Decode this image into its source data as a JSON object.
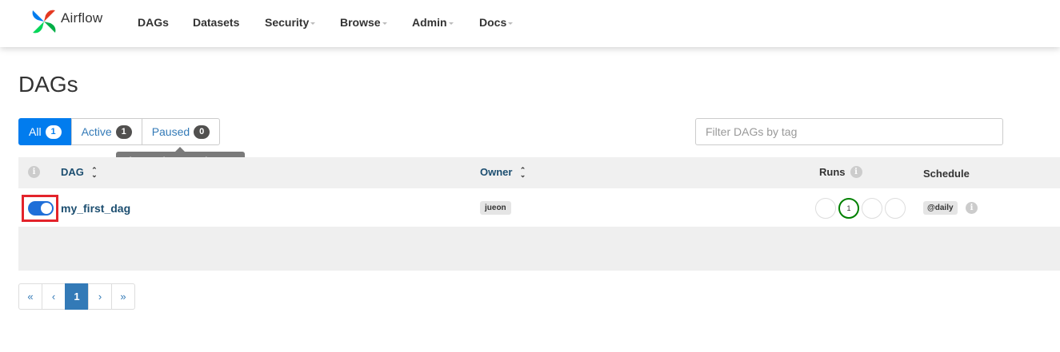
{
  "navbar": {
    "brand": "Airflow",
    "items": [
      {
        "label": "DAGs",
        "dropdown": false
      },
      {
        "label": "Datasets",
        "dropdown": false
      },
      {
        "label": "Security",
        "dropdown": true
      },
      {
        "label": "Browse",
        "dropdown": true
      },
      {
        "label": "Admin",
        "dropdown": true
      },
      {
        "label": "Docs",
        "dropdown": true
      }
    ]
  },
  "page": {
    "title": "DAGs"
  },
  "filters": {
    "all": {
      "label": "All",
      "count": "1"
    },
    "active": {
      "label": "Active",
      "count": "1"
    },
    "paused": {
      "label": "Paused",
      "count": "0"
    },
    "tooltip": "Show only paused DAGs",
    "tag_placeholder": "Filter DAGs by tag"
  },
  "table": {
    "headers": {
      "info": "i",
      "dag": "DAG",
      "owner": "Owner",
      "runs": "Runs",
      "schedule": "Schedule"
    },
    "rows": [
      {
        "dag_id": "my_first_dag",
        "owner": "jueon",
        "paused": false,
        "runs": [
          "",
          "1",
          "",
          ""
        ],
        "schedule": "@daily"
      }
    ]
  },
  "pagination": {
    "first": "«",
    "prev": "‹",
    "current": "1",
    "next": "›",
    "last": "»"
  },
  "colors": {
    "accent": "#017cee",
    "link": "#1c4e70",
    "success": "#008000",
    "highlight": "#e3232b"
  }
}
